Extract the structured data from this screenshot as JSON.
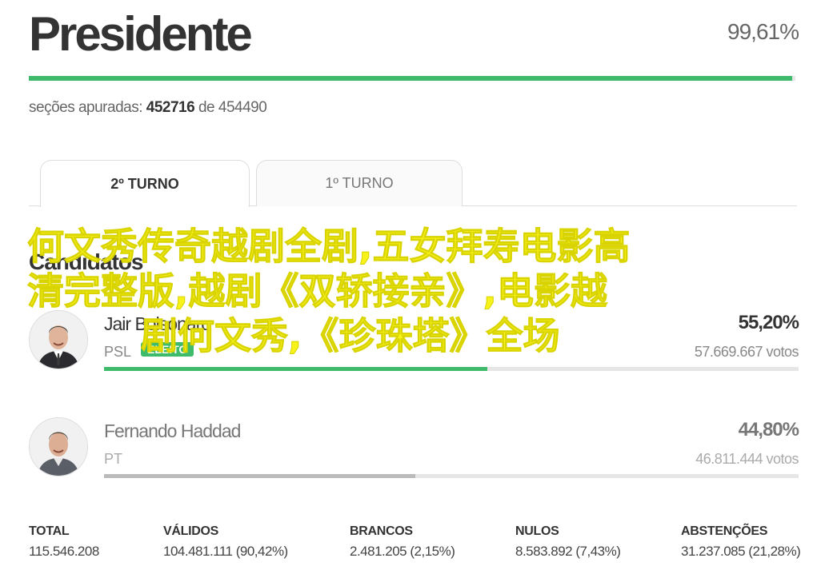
{
  "header": {
    "title": "Presidente",
    "percent_counted": "99,61%",
    "progress_fraction": 0.9961
  },
  "secoes": {
    "prefix": "seções apuradas:",
    "counted": "452716",
    "joiner": "de",
    "total": "454490"
  },
  "tabs": [
    {
      "label": "2º TURNO",
      "active": true
    },
    {
      "label": "1º TURNO",
      "active": false
    }
  ],
  "section_title": "Candidatos",
  "candidates": [
    {
      "name": "Jair Bolsonaro",
      "party": "PSL",
      "badge": "ELEITO",
      "percent": "55,20%",
      "votes": "57.669.667 votos",
      "share": 0.552,
      "bar_color": "#3dbb6b"
    },
    {
      "name": "Fernando Haddad",
      "party": "PT",
      "percent": "44,80%",
      "votes": "46.811.444 votos",
      "share": 0.448,
      "bar_color": "#bbbbbb"
    }
  ],
  "stats": [
    {
      "label": "TOTAL",
      "value": "115.546.208"
    },
    {
      "label": "VÁLIDOS",
      "value": "104.481.111 (90,42%)"
    },
    {
      "label": "BRANCOS",
      "value": "2.481.205 (2,15%)"
    },
    {
      "label": "NULOS",
      "value": "8.583.892 (7,43%)"
    },
    {
      "label": "ABSTENÇÕES",
      "value": "31.237.085 (21,28%)"
    }
  ],
  "overlay_text": {
    "line1": "何文秀传奇越剧全剧,五女拜寿电影高",
    "line2": "清完整版,越剧《双轿接亲》,电影越",
    "line3": "剧何文秀,《珍珠塔》全场"
  },
  "colors": {
    "accent_green": "#3dbb6b",
    "overlay_yellow": "#f7f21a"
  }
}
